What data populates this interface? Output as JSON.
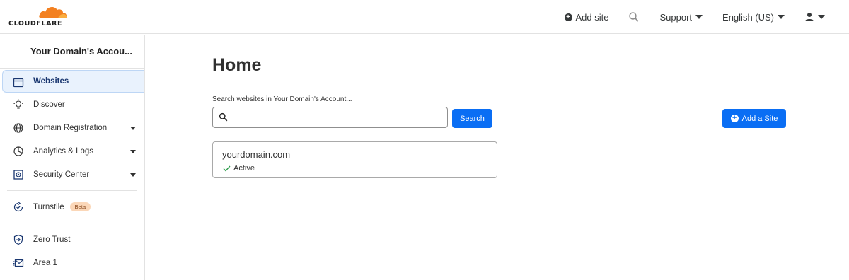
{
  "brand": {
    "name": "CLOUDFLARE",
    "accent": "#f38020",
    "primary": "#0a6ef4"
  },
  "topnav": {
    "add_site": "Add site",
    "search_icon": "search-icon",
    "support": "Support",
    "language": "English (US)",
    "user_icon": "user-icon"
  },
  "sidebar": {
    "account": "Your Domain's Accou...",
    "items": [
      {
        "label": "Websites",
        "icon": "browser-window-icon",
        "active": true,
        "expandable": false
      },
      {
        "label": "Discover",
        "icon": "lightbulb-icon",
        "expandable": false
      },
      {
        "label": "Domain Registration",
        "icon": "globe-icon",
        "expandable": true
      },
      {
        "label": "Analytics & Logs",
        "icon": "pie-chart-icon",
        "expandable": true
      },
      {
        "label": "Security Center",
        "icon": "security-center-icon",
        "expandable": true
      },
      {
        "label": "Turnstile",
        "icon": "turnstile-icon",
        "badge": "Beta"
      },
      {
        "label": "Zero Trust",
        "icon": "zero-trust-icon"
      },
      {
        "label": "Area 1",
        "icon": "envelope-icon"
      }
    ]
  },
  "main": {
    "title": "Home",
    "search_label": "Search websites in Your Domain's Account...",
    "search_value": "",
    "search_button": "Search",
    "add_button": "Add a Site",
    "sites": [
      {
        "domain": "yourdomain.com",
        "status": "Active"
      }
    ]
  }
}
